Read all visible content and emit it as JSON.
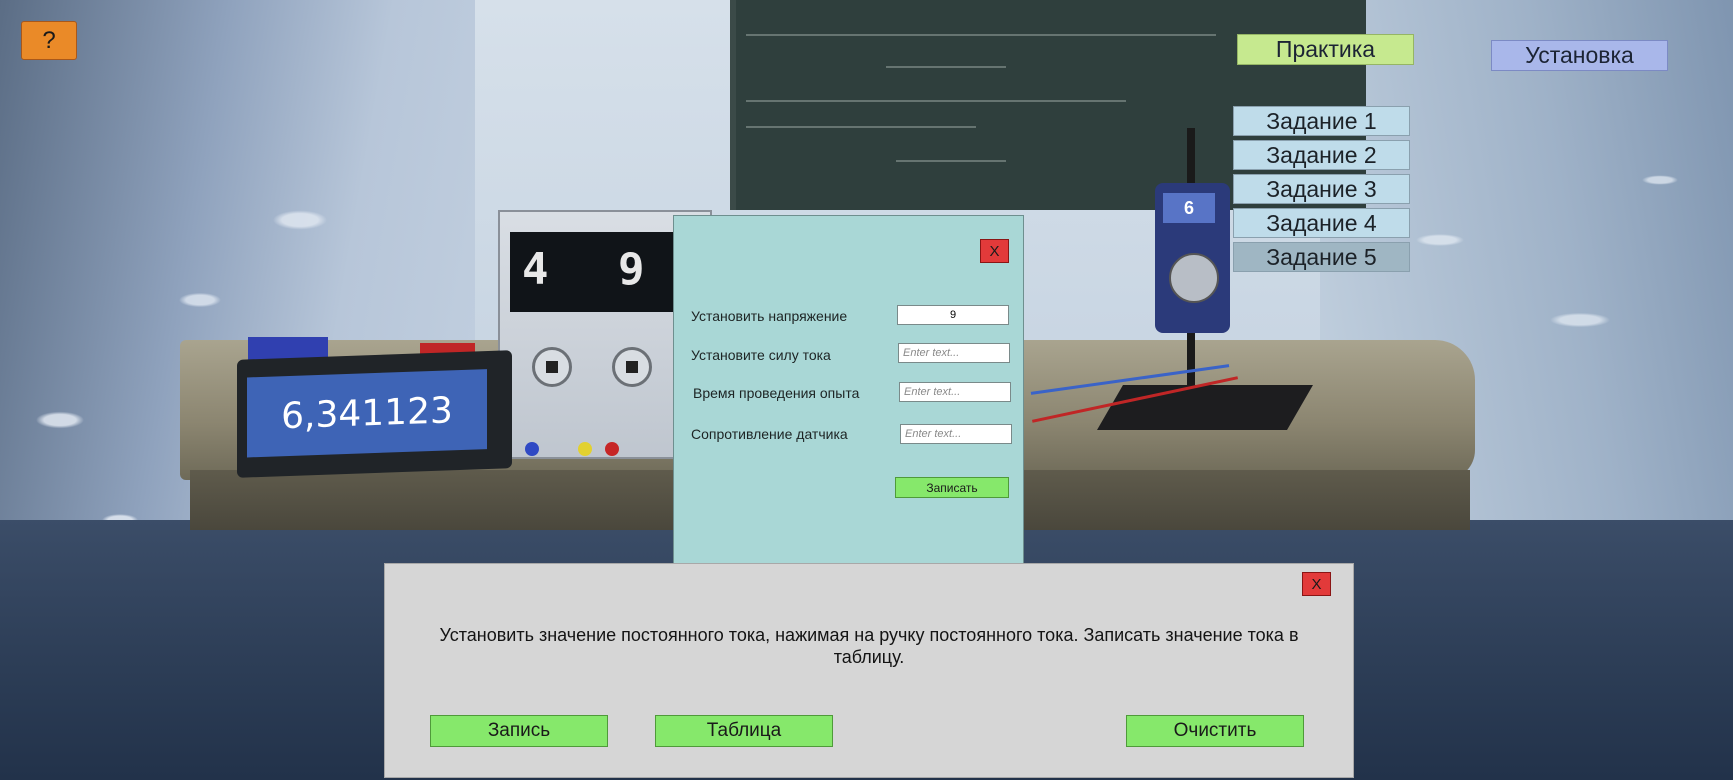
{
  "help": {
    "label": "?"
  },
  "tabs": {
    "practice": "Практика",
    "setup": "Установка"
  },
  "tasks": [
    {
      "label": "Задание 1"
    },
    {
      "label": "Задание 2"
    },
    {
      "label": "Задание 3"
    },
    {
      "label": "Задание 4"
    },
    {
      "label": "Задание 5"
    }
  ],
  "scene": {
    "psu_digits": [
      "4",
      "9"
    ],
    "meter_reading": "6,341123",
    "multimeter_reading": "6"
  },
  "dialog": {
    "close_label": "X",
    "fields": [
      {
        "label": "Установить напряжение",
        "value": "9",
        "placeholder": ""
      },
      {
        "label": "Установите силу тока",
        "value": "",
        "placeholder": "Enter text..."
      },
      {
        "label": "Время проведения опыта",
        "value": "",
        "placeholder": "Enter text..."
      },
      {
        "label": "Сопротивление датчика",
        "value": "",
        "placeholder": "Enter text..."
      }
    ],
    "submit_label": "Записать"
  },
  "bottom_panel": {
    "close_label": "X",
    "task_text": "Установить значение постоянного тока, нажимая на ручку постоянного тока. Записать значение тока в таблицу.",
    "buttons": {
      "record": "Запись",
      "table": "Таблица",
      "clear": "Очистить"
    }
  },
  "colors": {
    "help_button": "#ea8a28",
    "practice_tab": "#c6e98f",
    "setup_tab": "#a9b7ea",
    "task_item": "#bfdcea",
    "dialog_bg": "#a9d7d6",
    "close_red": "#e23a3a",
    "action_green": "#86e86b",
    "panel_bg": "#d6d6d6"
  }
}
